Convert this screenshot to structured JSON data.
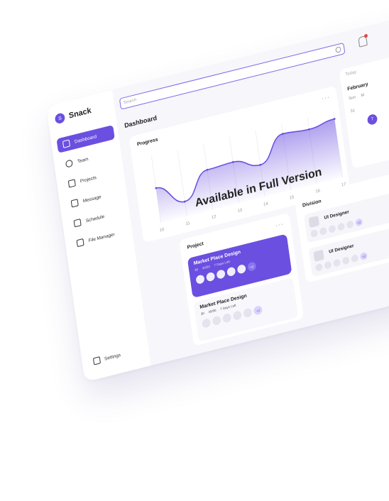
{
  "app": {
    "name": "Snack",
    "logo_letter": "S"
  },
  "nav": {
    "items": [
      {
        "label": "Dashboard",
        "icon": "grid-icon",
        "active": true
      },
      {
        "label": "Team",
        "icon": "user-icon",
        "active": false
      },
      {
        "label": "Projects",
        "icon": "folder-icon",
        "active": false
      },
      {
        "label": "Message",
        "icon": "chat-icon",
        "active": false
      },
      {
        "label": "Schedule",
        "icon": "calendar-icon",
        "active": false
      },
      {
        "label": "File Manager",
        "icon": "folder-open-icon",
        "active": false
      }
    ],
    "settings_label": "Settings"
  },
  "search": {
    "placeholder": "Search"
  },
  "page": {
    "title": "Dashboard"
  },
  "progress": {
    "title": "Progress",
    "overlay": "Available in Full Version",
    "chart_data": {
      "type": "area",
      "x": [
        10,
        11,
        12,
        13,
        14,
        15,
        16,
        17
      ],
      "values": [
        52,
        22,
        60,
        62,
        48,
        85,
        82,
        88
      ],
      "ylim": [
        0,
        100
      ],
      "xlabel": "",
      "ylabel": "",
      "grid": true
    }
  },
  "calendar": {
    "today_label": "Today",
    "month": "February",
    "weekdays": [
      "Sun",
      "M"
    ],
    "date": "31",
    "selected": "7"
  },
  "project": {
    "title": "Project",
    "items": [
      {
        "title": "Market Place Design",
        "meta1": "30",
        "meta2": "40/50",
        "meta3": "7 Days Left",
        "extra": "+2",
        "active": true
      },
      {
        "title": "Market Place Design",
        "meta1": "30",
        "meta2": "40/50",
        "meta3": "7 Days Left",
        "extra": "+2",
        "active": false
      }
    ]
  },
  "division": {
    "title": "Division",
    "items": [
      {
        "title": "UI Designer",
        "extra": "+2"
      },
      {
        "title": "UI Designer",
        "extra": "+2"
      }
    ]
  },
  "colors": {
    "accent": "#6b4fe0",
    "background": "#f6f6fb"
  }
}
